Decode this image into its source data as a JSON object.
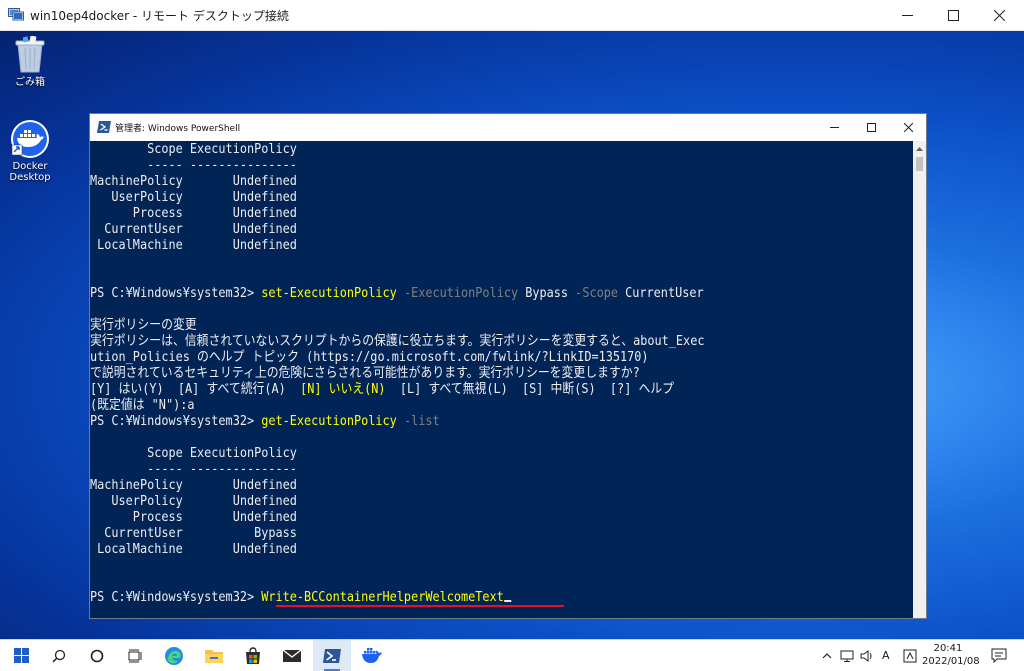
{
  "rdp": {
    "title": "win10ep4docker - リモート デスクトップ接続"
  },
  "desktop": {
    "icons": [
      {
        "label": "ごみ箱",
        "icon": "recycle-bin-icon"
      },
      {
        "label": "Docker Desktop",
        "label_lines": [
          "Docker",
          "Desktop"
        ],
        "icon": "docker-icon"
      }
    ]
  },
  "powershell": {
    "title": "管理者: Windows PowerShell",
    "colors": {
      "background": "#012456",
      "text": "#eeedf0",
      "command": "#ffff00",
      "parameter": "#808080"
    },
    "lines": [
      [
        {
          "t": "        Scope ExecutionPolicy"
        }
      ],
      [
        {
          "t": "        ----- ---------------"
        }
      ],
      [
        {
          "t": "MachinePolicy       Undefined"
        }
      ],
      [
        {
          "t": "   UserPolicy       Undefined"
        }
      ],
      [
        {
          "t": "      Process       Undefined"
        }
      ],
      [
        {
          "t": "  CurrentUser       Undefined"
        }
      ],
      [
        {
          "t": " LocalMachine       Undefined"
        }
      ],
      [
        {
          "t": ""
        }
      ],
      [
        {
          "t": ""
        }
      ],
      [
        {
          "t": "PS C:¥Windows¥system32> "
        },
        {
          "t": "set-ExecutionPolicy",
          "c": "cmd"
        },
        {
          "t": " "
        },
        {
          "t": "-ExecutionPolicy",
          "c": "par"
        },
        {
          "t": " Bypass "
        },
        {
          "t": "-Scope",
          "c": "par"
        },
        {
          "t": " CurrentUser"
        }
      ],
      [
        {
          "t": ""
        }
      ],
      [
        {
          "t": "実行ポリシーの変更"
        }
      ],
      [
        {
          "t": "実行ポリシーは、信頼されていないスクリプトからの保護に役立ちます。実行ポリシーを変更すると、about_Exec"
        }
      ],
      [
        {
          "t": "ution_Policies のヘルプ トピック (https://go.microsoft.com/fwlink/?LinkID=135170)"
        }
      ],
      [
        {
          "t": "で説明されているセキュリティ上の危険にさらされる可能性があります。実行ポリシーを変更しますか?"
        }
      ],
      [
        {
          "t": "[Y] はい(Y)  [A] すべて続行(A)  "
        },
        {
          "t": "[N] いいえ(N)",
          "c": "cmd"
        },
        {
          "t": "  [L] すべて無視(L)  [S] 中断(S)  [?] ヘルプ"
        }
      ],
      [
        {
          "t": "(既定値は \"N\"):a"
        }
      ],
      [
        {
          "t": "PS C:¥Windows¥system32> "
        },
        {
          "t": "get-ExecutionPolicy",
          "c": "cmd"
        },
        {
          "t": " "
        },
        {
          "t": "-list",
          "c": "par"
        }
      ],
      [
        {
          "t": ""
        }
      ],
      [
        {
          "t": "        Scope ExecutionPolicy"
        }
      ],
      [
        {
          "t": "        ----- ---------------"
        }
      ],
      [
        {
          "t": "MachinePolicy       Undefined"
        }
      ],
      [
        {
          "t": "   UserPolicy       Undefined"
        }
      ],
      [
        {
          "t": "      Process       Undefined"
        }
      ],
      [
        {
          "t": "  CurrentUser          Bypass"
        }
      ],
      [
        {
          "t": " LocalMachine       Undefined"
        }
      ],
      [
        {
          "t": ""
        }
      ],
      [
        {
          "t": ""
        }
      ],
      [
        {
          "t": "PS C:¥Windows¥system32> "
        },
        {
          "t": "Write-BCContainerHelperWelcomeText",
          "c": "cmd"
        },
        {
          "cursor": true
        }
      ]
    ]
  },
  "taskbar": {
    "tray": {
      "lang_indicator": "A",
      "time": "20:41",
      "date": "2022/01/08"
    }
  }
}
